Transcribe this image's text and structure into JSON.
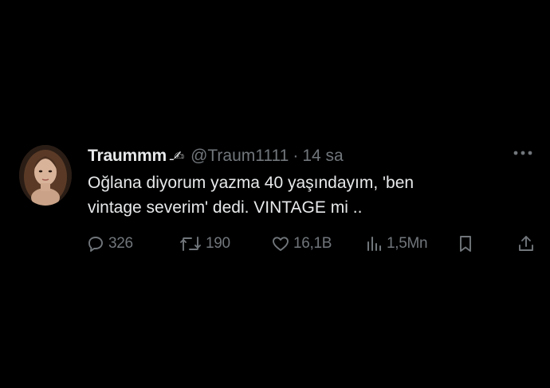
{
  "tweet": {
    "display_name": "Traummm",
    "name_emoji": "ـ✍",
    "handle": "@Traum1111",
    "separator": "·",
    "time": "14 sa",
    "text": "Oğlana diyorum yazma 40 yaşındayım, 'ben\nvintage severim' dedi. VINTAGE mi ..",
    "actions": {
      "reply_count": "326",
      "retweet_count": "190",
      "like_count": "16,1B",
      "view_count": "1,5Mn"
    }
  },
  "colors": {
    "background": "#000000",
    "primary_text": "#e7e9ea",
    "secondary_text": "#71767b"
  },
  "icons": [
    "more-icon",
    "reply-icon",
    "retweet-icon",
    "like-icon",
    "views-icon",
    "bookmark-icon",
    "share-icon"
  ]
}
